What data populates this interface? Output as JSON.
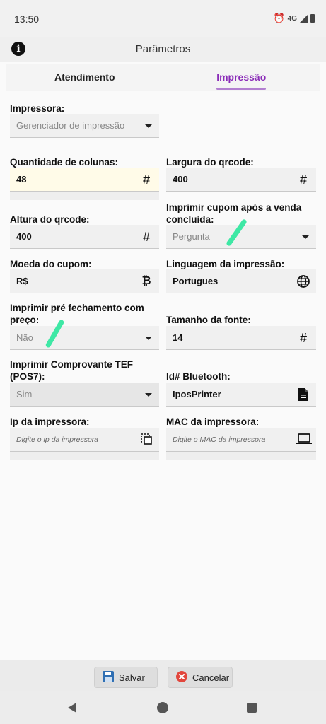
{
  "status_bar": {
    "time": "13:50",
    "network": "4G"
  },
  "app_bar": {
    "title": "Parâmetros"
  },
  "tabs": [
    {
      "label": "Atendimento",
      "active": false
    },
    {
      "label": "Impressão",
      "active": true
    }
  ],
  "form": {
    "impressora": {
      "label": "Impressora:",
      "value": "Gerenciador de impressão"
    },
    "quantidade_colunas": {
      "label": "Quantidade de colunas:",
      "value": "48",
      "icon": "hash-icon"
    },
    "largura_qrcode": {
      "label": "Largura do qrcode:",
      "value": "400",
      "icon": "hash-icon"
    },
    "altura_qrcode": {
      "label": "Altura do qrcode:",
      "value": "400",
      "icon": "hash-icon"
    },
    "imprimir_cupom": {
      "label": "Imprimir cupom após a venda concluída:",
      "value": "Pergunta"
    },
    "moeda_cupom": {
      "label": "Moeda do cupom:",
      "value": "R$",
      "icon": "bitcoin-icon"
    },
    "linguagem": {
      "label": "Linguagem da impressão:",
      "value": "Portugues",
      "icon": "globe-icon"
    },
    "pre_fechamento": {
      "label": "Imprimir pré fechamento com preço:",
      "value": "Não"
    },
    "tamanho_fonte": {
      "label": "Tamanho da fonte:",
      "value": "14",
      "icon": "hash-icon"
    },
    "comprovante_tef": {
      "label": "Imprimir Comprovante TEF (POS7):",
      "value": "Sim"
    },
    "id_bluetooth": {
      "label": "Id# Bluetooth:",
      "value": "IposPrinter",
      "icon": "document-icon"
    },
    "ip_impressora": {
      "label": "Ip da impressora:",
      "placeholder": "Digite o ip da impressora",
      "icon": "select-icon"
    },
    "mac_impressora": {
      "label": "MAC da impressora:",
      "placeholder": "Digite o MAC da impressora",
      "icon": "laptop-icon"
    }
  },
  "actions": {
    "save": "Salvar",
    "cancel": "Cancelar"
  },
  "colors": {
    "accent": "#8a2bb8",
    "save_icon": "#2f6fb3",
    "cancel_icon": "#e2473d",
    "highlight_field": "#fffbe8"
  }
}
